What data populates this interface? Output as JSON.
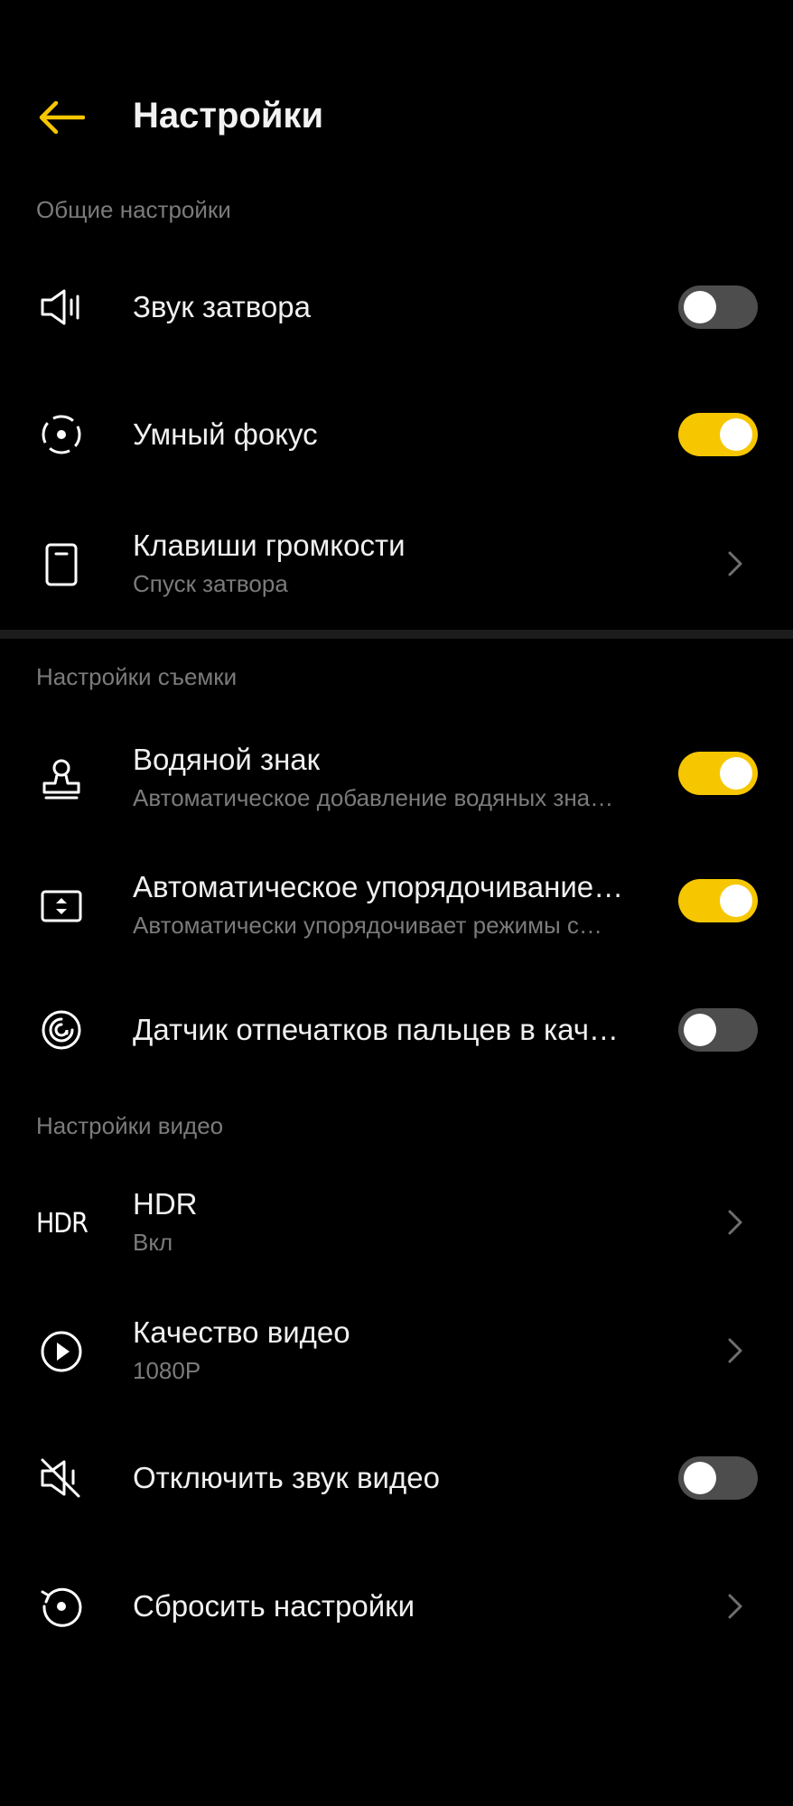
{
  "header": {
    "title": "Настройки",
    "back_icon": "arrow-left-icon",
    "accent_color": "#f6c700"
  },
  "sections": {
    "general": {
      "label": "Общие настройки"
    },
    "shooting": {
      "label": "Настройки съемки"
    },
    "video": {
      "label": "Настройки видео"
    }
  },
  "items": {
    "shutter_sound": {
      "title": "Звук затвора",
      "icon": "speaker-icon",
      "toggle": "off"
    },
    "smart_focus": {
      "title": "Умный фокус",
      "icon": "focus-icon",
      "toggle": "on"
    },
    "volume_keys": {
      "title": "Клавиши громкости",
      "subtitle": "Спуск затвора",
      "icon": "phone-volume-icon"
    },
    "watermark": {
      "title": "Водяной знак",
      "subtitle": "Автоматическое добавление водяных зна…",
      "icon": "stamp-icon",
      "toggle": "on"
    },
    "auto_sort": {
      "title": "Автоматическое упорядочивание…",
      "subtitle": "Автоматически упорядочивает режимы с…",
      "icon": "sort-icon",
      "toggle": "on"
    },
    "fingerprint": {
      "title": "Датчик отпечатков пальцев в кач…",
      "icon": "fingerprint-icon",
      "toggle": "off"
    },
    "hdr": {
      "title": "HDR",
      "subtitle": "Вкл",
      "icon": "hdr-icon",
      "icon_text": "HDR"
    },
    "video_quality": {
      "title": "Качество видео",
      "subtitle": "1080P",
      "icon": "play-circle-icon"
    },
    "mute_video": {
      "title": "Отключить звук видео",
      "icon": "speaker-muted-icon",
      "toggle": "off"
    },
    "reset": {
      "title": "Сбросить настройки",
      "icon": "reset-icon"
    }
  }
}
